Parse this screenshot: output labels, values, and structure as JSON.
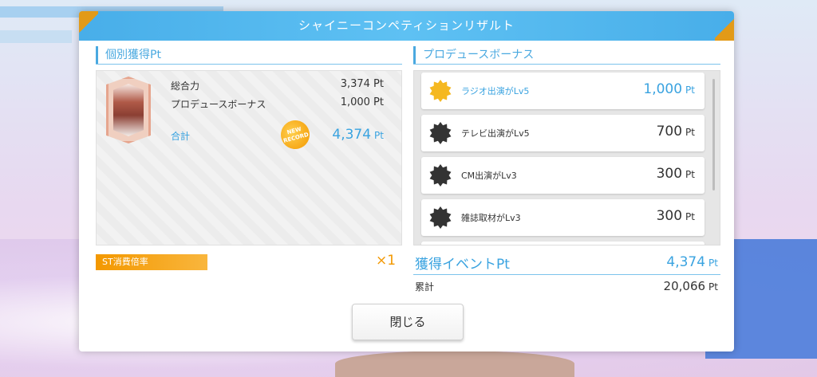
{
  "modal": {
    "title": "シャイニーコンペティションリザルト"
  },
  "individual": {
    "section_title": "個別獲得Pt",
    "stats": [
      {
        "label": "総合力",
        "value": "3,374 Pt"
      },
      {
        "label": "プロデュースボーナス",
        "value": "1,000 Pt"
      }
    ],
    "total_label": "合計",
    "total_value": "4,374",
    "total_unit": "Pt",
    "badge_line1": "NEW",
    "badge_line2": "RECORD"
  },
  "produce_bonus": {
    "section_title": "プロデュースボーナス",
    "items": [
      {
        "name": "ラジオ出演がLv5",
        "value": "1,000",
        "unit": "Pt",
        "icon": "gold-star-badge-icon",
        "active": true
      },
      {
        "name": "テレビ出演がLv5",
        "value": "700",
        "unit": "Pt",
        "icon": "black-star-badge-icon",
        "active": false
      },
      {
        "name": "CM出演がLv3",
        "value": "300",
        "unit": "Pt",
        "icon": "black-star-badge-icon",
        "active": false
      },
      {
        "name": "雑誌取材がLv3",
        "value": "300",
        "unit": "Pt",
        "icon": "black-star-badge-icon",
        "active": false
      }
    ]
  },
  "st_multiplier": {
    "label": "ST消費倍率",
    "value": "×1"
  },
  "event_points": {
    "label": "獲得イベントPt",
    "value": "4,374",
    "unit": "Pt",
    "cumulative_label": "累計",
    "cumulative_value": "20,066",
    "cumulative_unit": "Pt"
  },
  "close_button": {
    "label": "閉じる"
  },
  "colors": {
    "accent_blue": "#3aa3e0",
    "accent_orange": "#f39800",
    "header_blue": "#5ec1f3"
  }
}
